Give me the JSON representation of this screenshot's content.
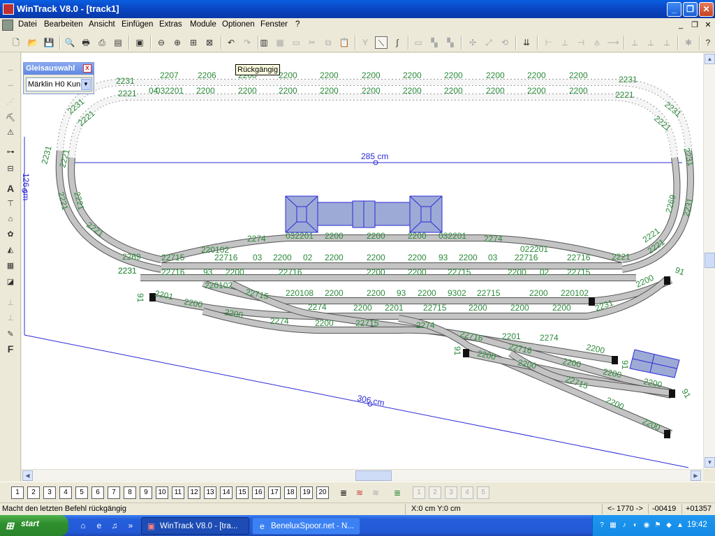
{
  "window": {
    "title": "WinTrack  V8.0 - [track1]"
  },
  "menu": [
    "Datei",
    "Bearbeiten",
    "Ansicht",
    "Einfügen",
    "Extras",
    "Module",
    "Optionen",
    "Fenster",
    "?"
  ],
  "tooltip": "Rückgängig",
  "gleisauswahl": {
    "title": "Gleisauswahl",
    "selected": "Märklin H0 Kun"
  },
  "dimensions": {
    "width": "285 cm",
    "height": "126 cm",
    "diagonal": "306 cm"
  },
  "track_labels": {
    "top_outer": [
      "2231",
      "2207",
      "2206",
      "2200",
      "2200",
      "2200",
      "2200",
      "2200",
      "2200",
      "2200",
      "2200",
      "2200",
      "2231"
    ],
    "top_inner": [
      "2221",
      "04",
      "032201",
      "2200",
      "2200",
      "2200",
      "2200",
      "2200",
      "2200",
      "2200",
      "2200",
      "2200",
      "2200",
      "2221"
    ],
    "left_curve": [
      "2231",
      "2221",
      "2231",
      "2221",
      "2221",
      "2221",
      "2231",
      "2221"
    ],
    "right_curve": [
      "2231",
      "2221",
      "2231",
      "2221",
      "2269",
      "2231",
      "2221",
      "2221",
      "2221"
    ],
    "row1": [
      "2274",
      "032201",
      "2200",
      "2200",
      "2200",
      "032201",
      "2274",
      "022201"
    ],
    "row2": [
      "2269",
      "22715",
      "220102",
      "22716",
      "03",
      "2200",
      "02",
      "2200",
      "2200",
      "2200",
      "93",
      "2200",
      "03",
      "22716",
      "22716"
    ],
    "row3": [
      "2231",
      "22716",
      "93",
      "2200",
      "22716",
      "2200",
      "2200",
      "22715",
      "2200",
      "02",
      "22715"
    ],
    "row4": [
      "2201",
      "220102",
      "22715",
      "220108",
      "2200",
      "2200",
      "93",
      "2200",
      "9302",
      "22715",
      "2200",
      "220102",
      "2200"
    ],
    "row5": [
      "91",
      "2200",
      "2274",
      "2200",
      "2201",
      "22715",
      "2200",
      "2200",
      "2200",
      "2231"
    ],
    "row6": [
      "2200",
      "2274",
      "2200",
      "22715",
      "2274"
    ],
    "fan": [
      "22716",
      "2201",
      "2274",
      "2200",
      "22716",
      "91",
      "2200",
      "2200",
      "2200",
      "22715",
      "2200",
      "2200",
      "2200",
      "91",
      "91",
      "2200"
    ],
    "bumpers": [
      "91",
      "91",
      "91",
      "91",
      "91"
    ]
  },
  "layers": [
    "1",
    "2",
    "3",
    "4",
    "5",
    "6",
    "7",
    "8",
    "9",
    "10",
    "11",
    "12",
    "13",
    "14",
    "15",
    "16",
    "17",
    "18",
    "19",
    "20"
  ],
  "layers_right": [
    "1",
    "2",
    "3",
    "4",
    "5"
  ],
  "status": {
    "message": "Macht den letzten Befehl rückgängig",
    "coords": "X:0 cm Y:0 cm",
    "angle": "<- 1770 ->",
    "v1": "-00419",
    "v2": "+01357"
  },
  "taskbar": {
    "start": "start",
    "tasks": [
      "WinTrack  V8.0 - [tra...",
      "BeneluxSpoor.net - N..."
    ],
    "clock": "19:42"
  },
  "colors": {
    "track_fill": "#c0c0c0",
    "label": "#2a8a3a",
    "dim": "#2b2bd8",
    "building": "#9daad6"
  }
}
